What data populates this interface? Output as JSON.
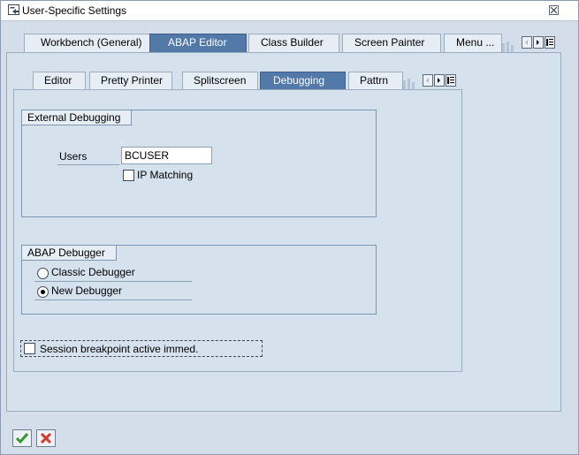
{
  "window": {
    "title": "User-Specific Settings"
  },
  "outer_tabs": [
    {
      "label": "Workbench (General)",
      "active": false
    },
    {
      "label": "ABAP Editor",
      "active": true
    },
    {
      "label": "Class Builder",
      "active": false
    },
    {
      "label": "Screen Painter",
      "active": false
    },
    {
      "label": "Menu ...",
      "active": false
    }
  ],
  "inner_tabs": [
    {
      "label": "Editor",
      "active": false
    },
    {
      "label": "Pretty Printer",
      "active": false
    },
    {
      "label": "Splitscreen",
      "active": false
    },
    {
      "label": "Debugging",
      "active": true
    },
    {
      "label": "Pattrn",
      "active": false
    }
  ],
  "external_debugging": {
    "title": "External Debugging",
    "users_label": "Users",
    "users_value": "BCUSER",
    "ip_matching_label": "IP Matching",
    "ip_matching_checked": false
  },
  "abap_debugger": {
    "title": "ABAP Debugger",
    "options": [
      {
        "label": "Classic Debugger",
        "selected": false
      },
      {
        "label": "New Debugger",
        "selected": true
      }
    ]
  },
  "session_breakpoint": {
    "label": "Session breakpoint active immed.",
    "checked": false
  },
  "footer": {
    "confirm_icon": "checkmark-icon",
    "cancel_icon": "cancel-x-icon"
  },
  "colors": {
    "active_tab": "#5279a8",
    "panel": "#d6e1ee",
    "confirm_green": "#2f9b2f",
    "cancel_red": "#d43a2a"
  }
}
